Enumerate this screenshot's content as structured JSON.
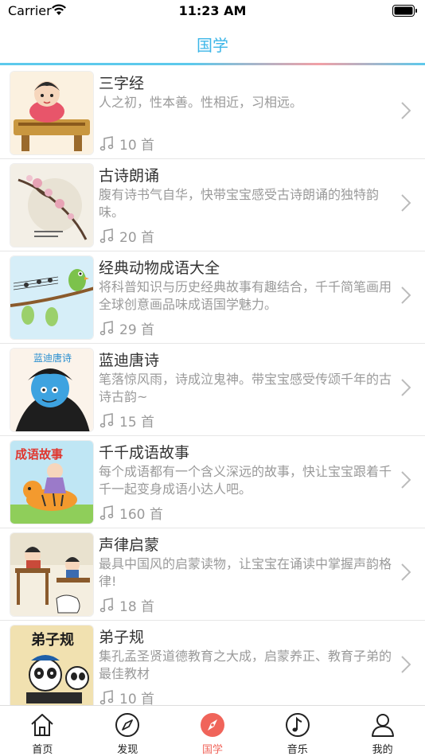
{
  "status": {
    "carrier": "Carrier",
    "time": "11:23 AM"
  },
  "nav": {
    "title": "国学"
  },
  "items": [
    {
      "title": "三字经",
      "desc": "人之初，性本善。性相近，习相远。",
      "count": "10 首"
    },
    {
      "title": "古诗朗诵",
      "desc": "腹有诗书气自华，快带宝宝感受古诗朗诵的独特韵味。",
      "count": "20 首"
    },
    {
      "title": "经典动物成语大全",
      "desc": "将科普知识与历史经典故事有趣结合，千千简笔画用全球创意画品味成语国学魅力。",
      "count": "29 首"
    },
    {
      "title": "蓝迪唐诗",
      "desc": "笔落惊风雨，诗成泣鬼神。带宝宝感受传颂千年的古诗古韵~",
      "count": "15 首",
      "thumb_text": "蓝迪唐诗"
    },
    {
      "title": "千千成语故事",
      "desc": "每个成语都有一个含义深远的故事，快让宝宝跟着千千一起变身成语小达人吧。",
      "count": "160 首",
      "thumb_text": "成语故事"
    },
    {
      "title": "声律启蒙",
      "desc": "最具中国风的启蒙读物，让宝宝在诵读中掌握声韵格律!",
      "count": "18 首"
    },
    {
      "title": "弟子规",
      "desc": "集孔孟圣贤道德教育之大成，启蒙养正、教育子弟的最佳教材",
      "count": "10 首",
      "thumb_text": "弟子规"
    }
  ],
  "tabs": [
    {
      "label": "首页",
      "icon": "home-icon"
    },
    {
      "label": "发现",
      "icon": "compass-icon"
    },
    {
      "label": "国学",
      "icon": "compass-filled-icon",
      "active": true
    },
    {
      "label": "音乐",
      "icon": "music-note-icon"
    },
    {
      "label": "我的",
      "icon": "person-icon"
    }
  ],
  "colors": {
    "accent": "#3cb6e8",
    "active_tab": "#f0645a",
    "text_primary": "#333333",
    "text_secondary": "#9a9a9a"
  }
}
